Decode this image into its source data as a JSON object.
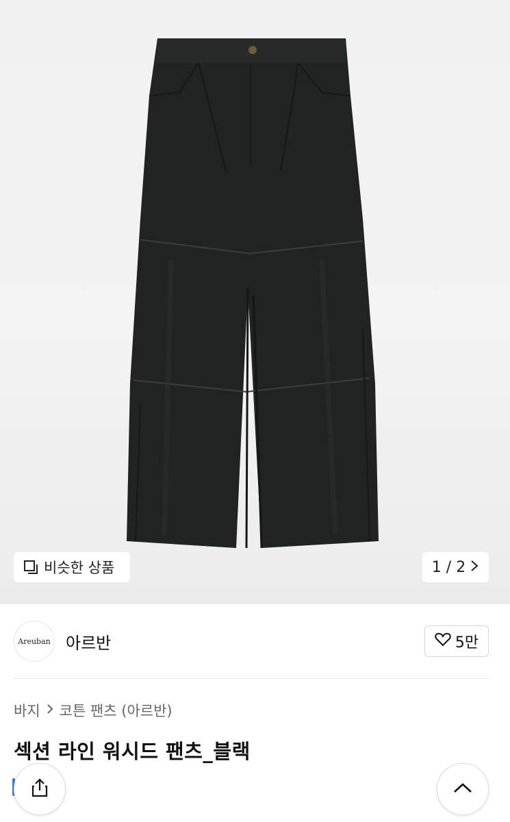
{
  "product_image": {
    "alt": "black wide pants",
    "icon": "pants-image"
  },
  "similar_button": {
    "label": "비슷한 상품",
    "icon": "similar-items-icon"
  },
  "pager": {
    "text": "1 / 2",
    "icon": "chevron-right-icon"
  },
  "brand": {
    "logo_text": "Areuban",
    "name": "아르반"
  },
  "like": {
    "count": "5만",
    "icon": "heart-icon"
  },
  "breadcrumb": {
    "items": [
      "바지",
      "코튼 팬츠 (아르반)"
    ],
    "separator_icon": "chevron-right-icon"
  },
  "product": {
    "title": "섹션 라인 워시드 팬츠_블랙"
  },
  "actions": {
    "share_icon": "share-icon",
    "scroll_top_icon": "chevron-up-icon"
  }
}
